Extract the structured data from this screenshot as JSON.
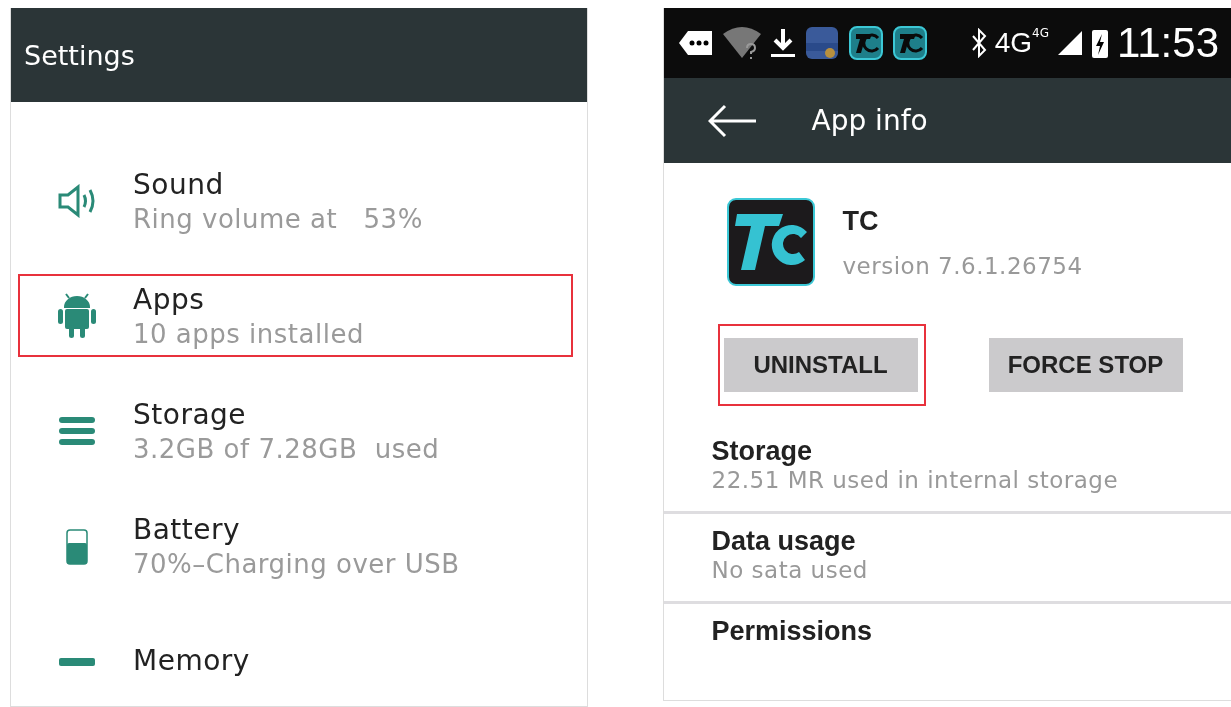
{
  "settings_screen": {
    "title": "Settings",
    "items": [
      {
        "kind": "sound",
        "title": "Sound",
        "subtitle": "Ring volume at   53%",
        "highlighted": false
      },
      {
        "kind": "android",
        "title": "Apps",
        "subtitle": "10 apps installed",
        "highlighted": true
      },
      {
        "kind": "storage",
        "title": "Storage",
        "subtitle": "3.2GB of 7.28GB  used",
        "highlighted": false
      },
      {
        "kind": "battery",
        "title": "Battery",
        "subtitle": "70%–Charging over USB",
        "highlighted": false
      },
      {
        "kind": "memory",
        "title": "Memory",
        "highlighted": false
      }
    ]
  },
  "app_info_screen": {
    "status_bar": {
      "network": "4G",
      "network_badge": "4G",
      "time": "11:53"
    },
    "title": "App info",
    "app": {
      "name": "TC",
      "version": "version 7.6.1.26754"
    },
    "buttons": [
      {
        "label": "UNINSTALL",
        "highlighted": true
      },
      {
        "label": "FORCE STOP",
        "highlighted": false
      }
    ],
    "sections": [
      {
        "title": "Storage",
        "subtitle": "22.51 MR used in internal storage"
      },
      {
        "title": "Data usage",
        "subtitle": "No sata used"
      },
      {
        "title": "Permissions"
      }
    ]
  }
}
